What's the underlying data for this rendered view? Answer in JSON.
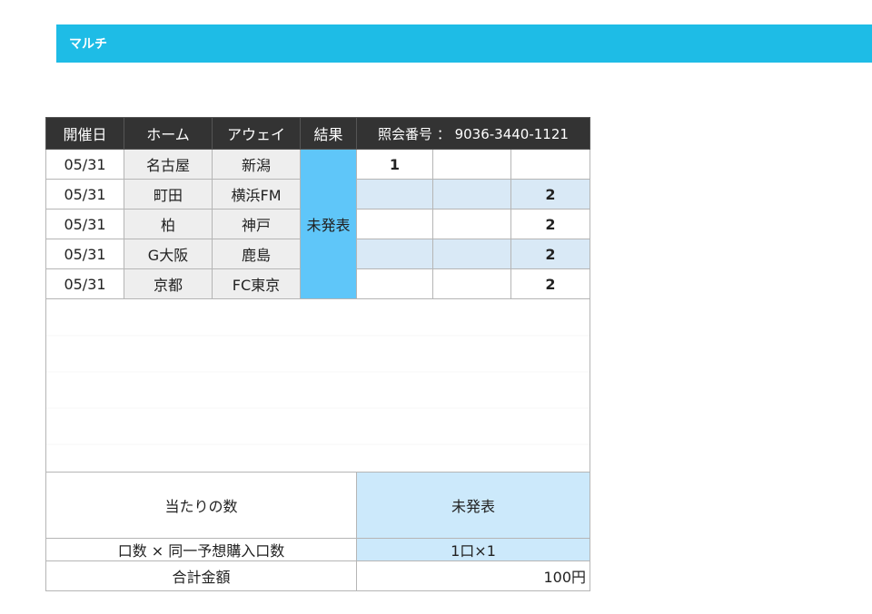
{
  "header": {
    "title": "マルチ"
  },
  "table": {
    "columns": {
      "date": "開催日",
      "home": "ホーム",
      "away": "アウェイ",
      "result": "結果",
      "reference": "照会番号 ： 9036-3440-1121"
    },
    "result_status": "未発表",
    "matches": [
      {
        "date": "05/31",
        "home": "名古屋",
        "away": "新潟",
        "picks": [
          "1",
          "",
          ""
        ]
      },
      {
        "date": "05/31",
        "home": "町田",
        "away": "横浜FM",
        "picks": [
          "",
          "",
          "2"
        ]
      },
      {
        "date": "05/31",
        "home": "柏",
        "away": "神戸",
        "picks": [
          "",
          "",
          "2"
        ]
      },
      {
        "date": "05/31",
        "home": "G大阪",
        "away": "鹿島",
        "picks": [
          "",
          "",
          "2"
        ]
      },
      {
        "date": "05/31",
        "home": "京都",
        "away": "FC東京",
        "picks": [
          "",
          "",
          "2"
        ]
      }
    ]
  },
  "summary": {
    "hits_label": "当たりの数",
    "hits_value": "未発表",
    "units_label": "口数 × 同一予想購入口数",
    "units_value": "1口×1",
    "total_label": "合計金額",
    "total_value": "100円"
  },
  "colors": {
    "header": "#1ebce6",
    "table_header": "#333333",
    "result_cell": "#5fc6f9",
    "shaded_row": "#d9e9f6",
    "summary_value": "#cce9fb"
  }
}
